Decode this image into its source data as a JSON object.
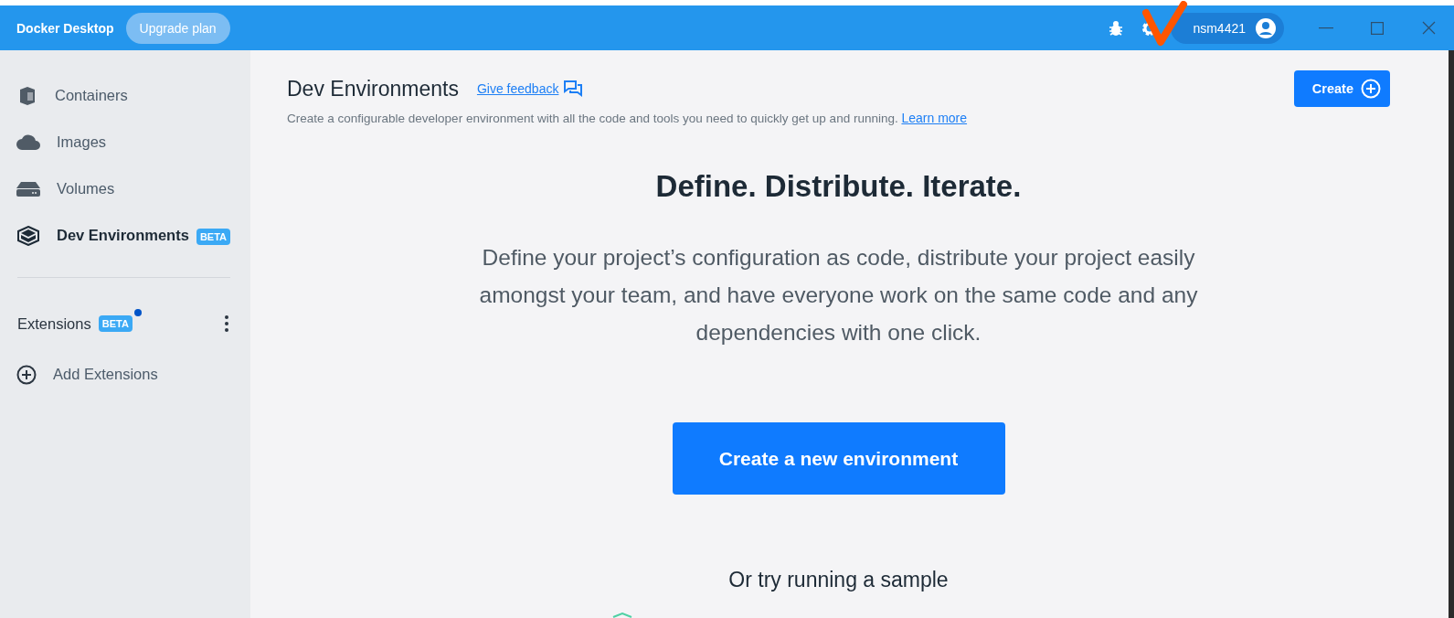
{
  "title_bar": {
    "app_name": "Docker Desktop",
    "upgrade_button": "Upgrade plan",
    "username": "nsm4421"
  },
  "sidebar": {
    "items": [
      {
        "label": "Containers",
        "kind": "container",
        "selected": false
      },
      {
        "label": "Images",
        "kind": "cloud",
        "selected": false
      },
      {
        "label": "Volumes",
        "kind": "drive",
        "selected": false
      },
      {
        "label": "Dev Environments",
        "kind": "cube",
        "selected": true,
        "badge": "BETA"
      }
    ],
    "extensions": {
      "label": "Extensions",
      "badge": "BETA",
      "has_notification": true
    },
    "add_extensions": "Add Extensions"
  },
  "header": {
    "title": "Dev Environments",
    "feedback_link": "Give feedback",
    "description": "Create a configurable developer environment with all the code and tools you need to quickly get up and running.",
    "learn_more": "Learn more",
    "create_button": "Create"
  },
  "hero": {
    "heading": "Define. Distribute. Iterate.",
    "body": "Define your project’s configuration as code, distribute your project easily amongst your team, and have everyone work on the same code and any dependencies with one click.",
    "cta": "Create a new environment",
    "sample_heading": "Or try running a sample"
  }
}
